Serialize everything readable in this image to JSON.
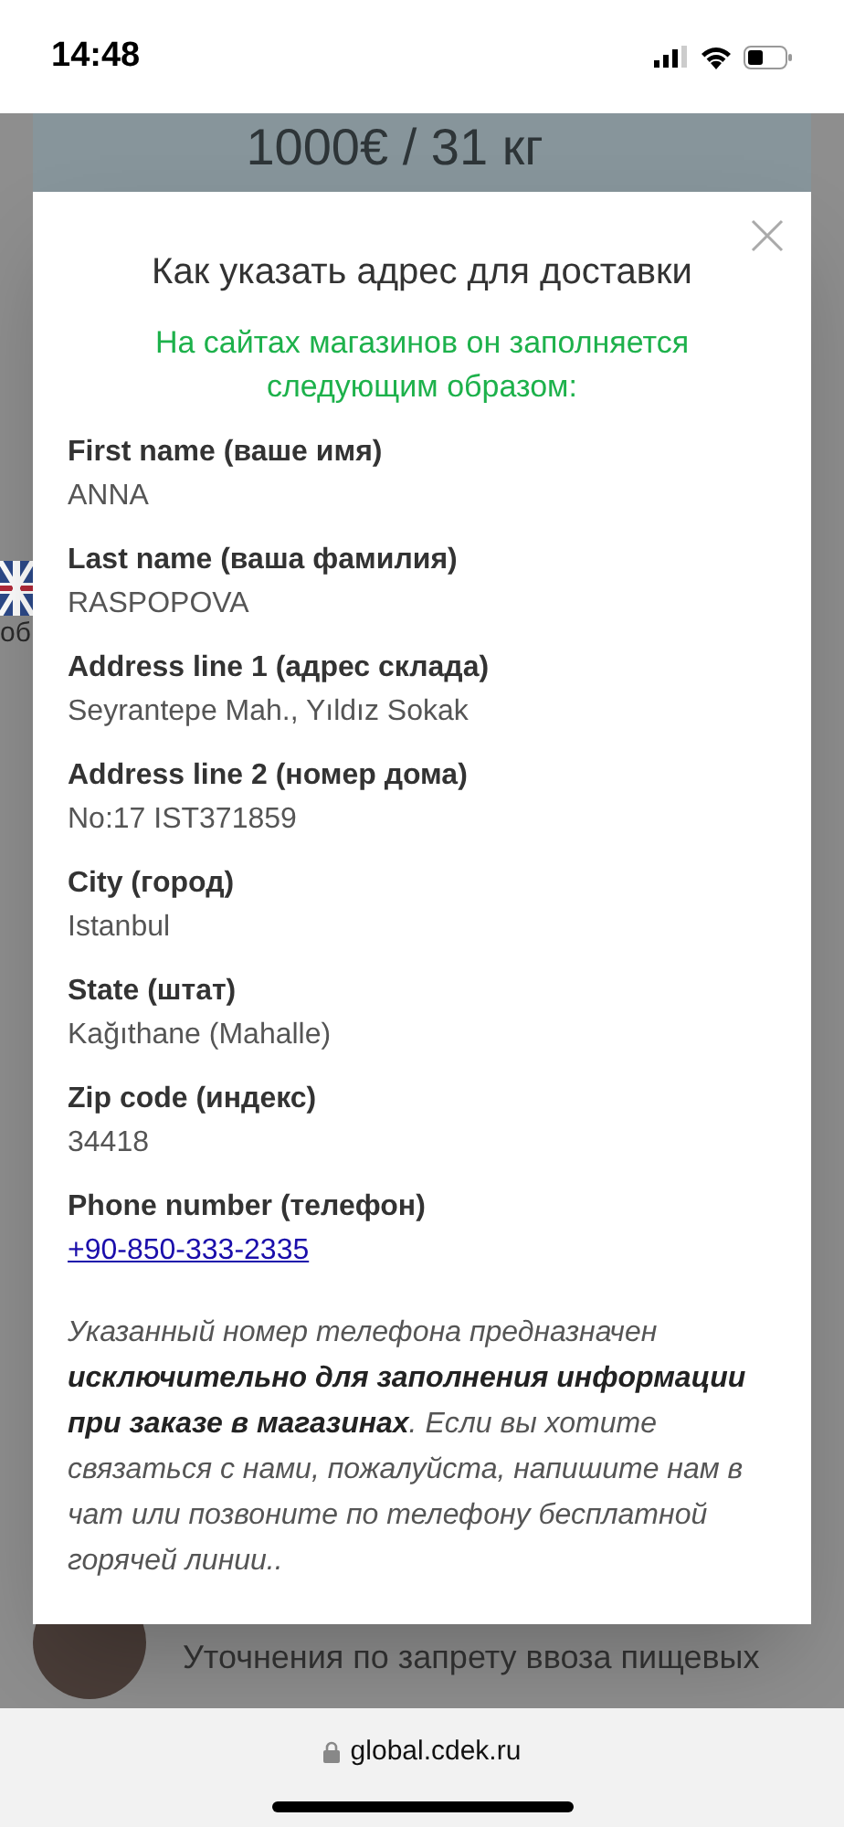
{
  "status_bar": {
    "time": "14:48"
  },
  "background": {
    "banner_text": "1000€ / 31 кг",
    "side_text": "об",
    "message_preview": "Уточнения по запрету ввоза пищевых"
  },
  "modal": {
    "title": "Как указать адрес для доставки",
    "subtitle": "На сайтах магазинов он заполняется следующим образом:",
    "fields": [
      {
        "label": "First name (ваше имя)",
        "value": "ANNA",
        "kind": "text"
      },
      {
        "label": "Last name (ваша фамилия)",
        "value": "RASPOPOVA",
        "kind": "text"
      },
      {
        "label": "Address line 1 (адрес склада)",
        "value": "Seyrantepe Mah., Yıldız Sokak",
        "kind": "text"
      },
      {
        "label": "Address line 2 (номер дома)",
        "value": "No:17 IST371859",
        "kind": "text"
      },
      {
        "label": "City (город)",
        "value": "Istanbul",
        "kind": "text"
      },
      {
        "label": "State (штат)",
        "value": "Kağıthane (Mahalle)",
        "kind": "text"
      },
      {
        "label": "Zip code (индекс)",
        "value": "34418",
        "kind": "text"
      },
      {
        "label": "Phone number (телефон)",
        "value": "+90-850-333-2335",
        "kind": "link"
      }
    ],
    "note": "Указанный номер телефона предназначен **исключительно для заполнения информации при заказе в магазинах**. Если вы хотите связаться с нами, пожалуйста, напишите нам в чат или позвоните по телефону бесплатной горячей линии.."
  },
  "browser_bar": {
    "url": "global.cdek.ru"
  }
}
